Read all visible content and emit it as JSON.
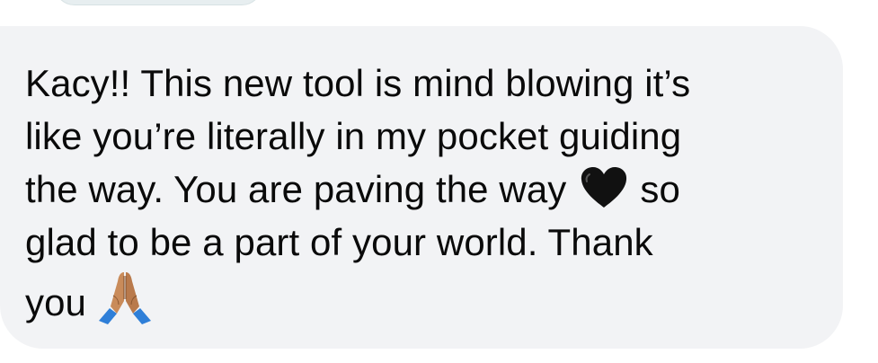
{
  "message": {
    "line1": "Kacy!! This new tool is mind blowing it’s",
    "line2": "like you’re literally in my pocket guiding",
    "line3a": "the way.  You are paving the way",
    "line3b": "so",
    "line4": "glad to be a part of your world.   Thank",
    "line5": "you",
    "emojis": [
      "black-heart-icon",
      "folded-hands-icon"
    ]
  },
  "colors": {
    "bubble": "#f2f3f5",
    "text": "#0a0a0a",
    "heart": "#111111",
    "hands_skin": "#c98b5a",
    "sleeves": "#2f7fd8"
  }
}
